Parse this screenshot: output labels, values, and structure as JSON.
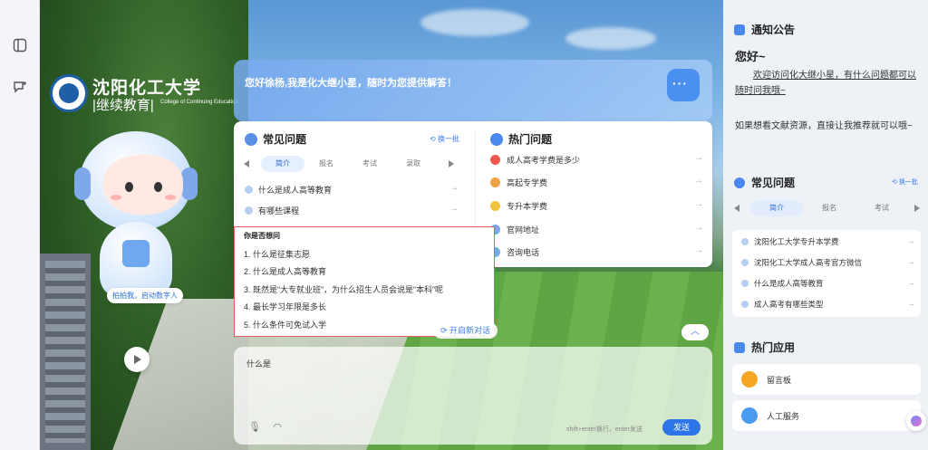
{
  "logo": {
    "name": "沈阳化工大学",
    "subtitle": "|继续教育|",
    "english": "College of Continuing Education"
  },
  "mascot": {
    "label": "拍拍我，启动数字人"
  },
  "greeting": {
    "text": "您好徐杨,我是化大继小星，随时为您提供解答！"
  },
  "faq": {
    "title": "常见问题",
    "refresh": "换一批",
    "tabs": [
      "简介",
      "报名",
      "考试",
      "录取"
    ],
    "active_tab": "简介",
    "items": [
      "什么是成人高等教育",
      "有哪些课程"
    ]
  },
  "hot": {
    "title": "热门问题",
    "items": [
      {
        "label": "成人高考学费是多少",
        "color": "#f0574d"
      },
      {
        "label": "高起专学费",
        "color": "#f0a045"
      },
      {
        "label": "专升本学费",
        "color": "#f2c23d"
      },
      {
        "label": "官网地址",
        "color": "#7aa6ee"
      },
      {
        "label": "咨询电话",
        "color": "#7aa6ee"
      }
    ]
  },
  "suggest": {
    "title": "你是否想问",
    "items": [
      "1. 什么是征集志愿",
      "2. 什么是成人高等教育",
      "3. 既然是“大专就业班”，为什么招生人员会说是“本科”呢",
      "4. 最长学习年限是多长",
      "5. 什么条件可免试入学"
    ]
  },
  "chat": {
    "new_chat": "开启新对话",
    "input_value": "什么是",
    "hint": "shift+enter换行，enter发送",
    "send": "发送"
  },
  "notice": {
    "title": "通知公告",
    "hello": "您好~",
    "body": "欢迎访问化大继小星，有什么问题都可以随时问我哦~",
    "body2": "如果想看文献资源，直接让我推荐就可以哦~"
  },
  "right_faq": {
    "title": "常见问题",
    "refresh": "换一批",
    "tabs": [
      "简介",
      "报名",
      "考试"
    ],
    "active_tab": "简介",
    "items": [
      "沈阳化工大学专升本学费",
      "沈阳化工大学成人高考官方微信",
      "什么是成人高等教育",
      "成人高考有哪些类型"
    ]
  },
  "apps": {
    "title": "热门应用",
    "items": [
      {
        "label": "留言板",
        "color": "#f5a623"
      },
      {
        "label": "人工服务",
        "color": "#4a9bf0"
      }
    ]
  }
}
